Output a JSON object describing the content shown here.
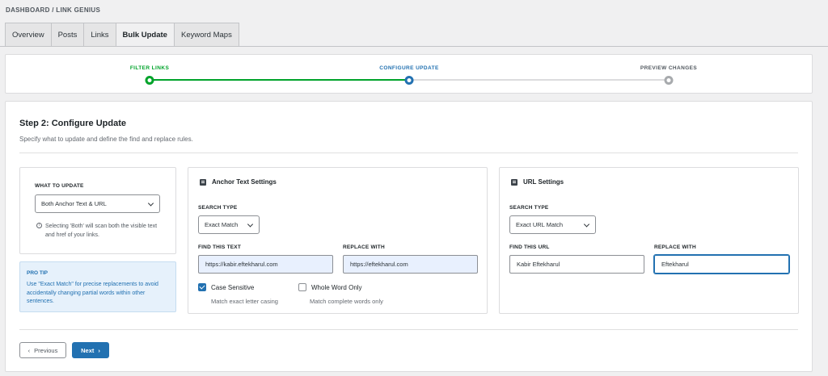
{
  "breadcrumb": "DASHBOARD / LINK GENIUS",
  "tabs": [
    "Overview",
    "Posts",
    "Links",
    "Bulk Update",
    "Keyword Maps"
  ],
  "active_tab": "Bulk Update",
  "steps": [
    {
      "label": "FILTER LINKS",
      "status": "completed"
    },
    {
      "label": "CONFIGURE UPDATE",
      "status": "current"
    },
    {
      "label": "PREVIEW CHANGES",
      "status": "upcoming"
    }
  ],
  "colors": {
    "completed": "#00a32a",
    "current": "#2271b1",
    "upcoming": "#c3c4c7",
    "protip_bg": "#e6f1fb",
    "protip_text": "#2271b1"
  },
  "main": {
    "title": "Step 2: Configure Update",
    "subtitle": "Specify what to update and define the find and replace rules."
  },
  "what_to_update": {
    "label": "WHAT TO UPDATE",
    "selected": "Both Anchor Text & URL",
    "note": "Selecting 'Both' will scan both the visible text and href of your links."
  },
  "pro_tip": {
    "title": "PRO TIP",
    "text": "Use \"Exact Match\" for precise replacements to avoid accidentally changing partial words within other sentences."
  },
  "anchor": {
    "title": "Anchor Text Settings",
    "search_type_label": "SEARCH TYPE",
    "search_type": "Exact Match",
    "find_label": "FIND THIS TEXT",
    "find_value": "https://kabir.eftekharul.com",
    "replace_label": "REPLACE WITH",
    "replace_value": "https://eftekharul.com",
    "case_sensitive": {
      "label": "Case Sensitive",
      "hint": "Match exact letter casing",
      "checked": true
    },
    "whole_word": {
      "label": "Whole Word Only",
      "hint": "Match complete words only",
      "checked": false
    }
  },
  "url": {
    "title": "URL Settings",
    "search_type_label": "SEARCH TYPE",
    "search_type": "Exact URL Match",
    "find_label": "FIND THIS URL",
    "find_value": "Kabir Eftekharul",
    "replace_label": "REPLACE WITH",
    "replace_value": "Eftekharul"
  },
  "buttons": {
    "previous": "Previous",
    "next": "Next"
  }
}
